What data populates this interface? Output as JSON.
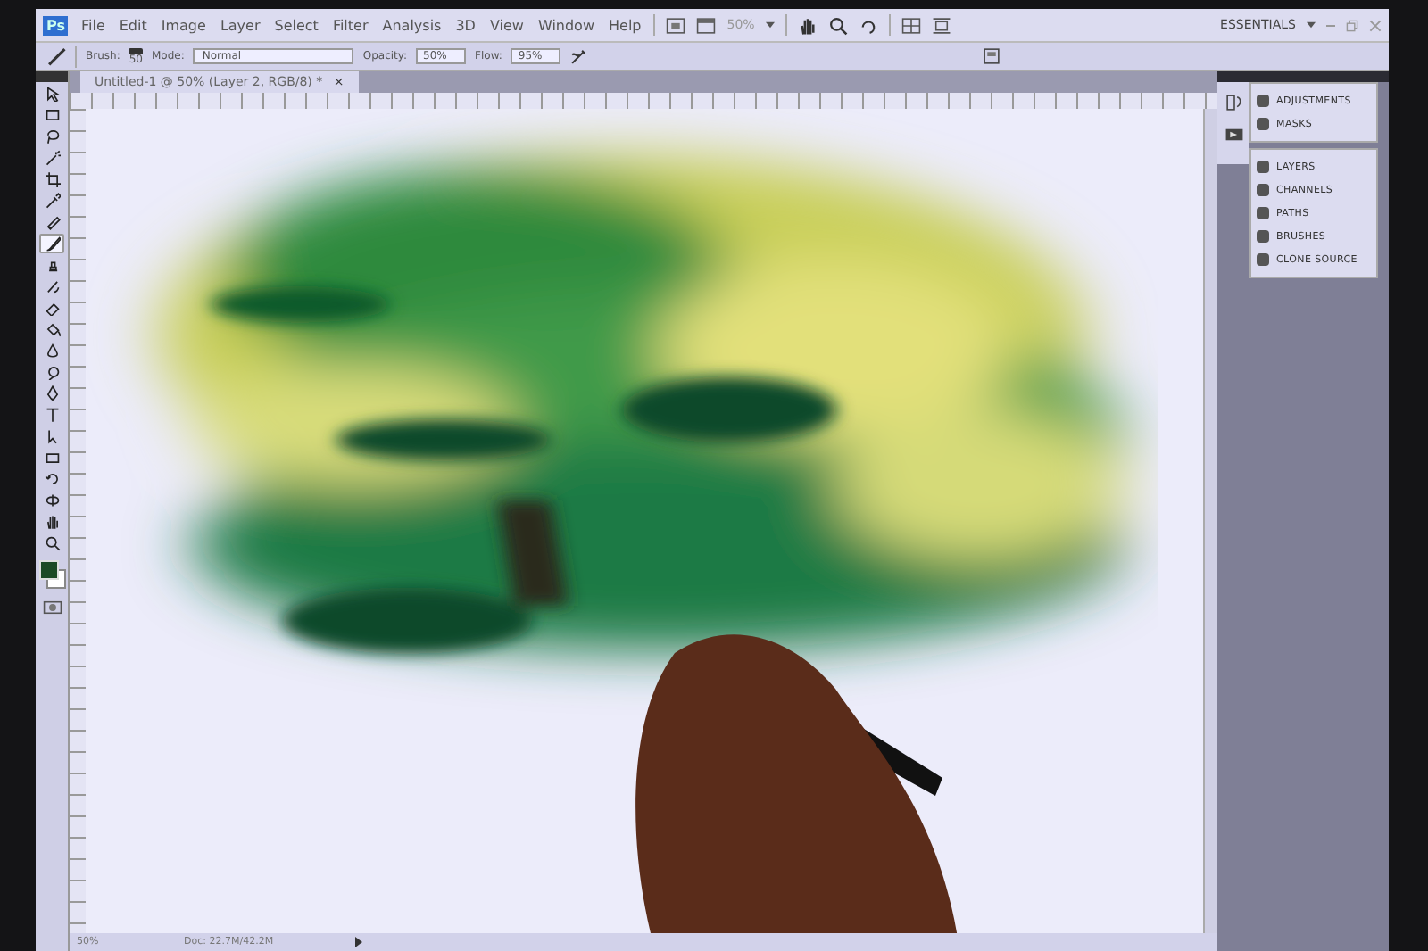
{
  "app_logo": "Ps",
  "menu": [
    "File",
    "Edit",
    "Image",
    "Layer",
    "Select",
    "Filter",
    "Analysis",
    "3D",
    "View",
    "Window",
    "Help"
  ],
  "app_bar": {
    "zoom": "50%",
    "workspace": "ESSENTIALS"
  },
  "options_bar": {
    "brush_label": "Brush:",
    "brush_size": "50",
    "mode_label": "Mode:",
    "mode": "Normal",
    "opacity_label": "Opacity:",
    "opacity": "50%",
    "flow_label": "Flow:",
    "flow": "95%"
  },
  "document_tab": {
    "title": "Untitled-1 @ 50% (Layer 2, RGB/8) *",
    "close": "×"
  },
  "tools": [
    {
      "kind": "move",
      "selected": false
    },
    {
      "kind": "marquee",
      "selected": false
    },
    {
      "kind": "lasso",
      "selected": false
    },
    {
      "kind": "wand",
      "selected": false
    },
    {
      "kind": "crop",
      "selected": false
    },
    {
      "kind": "eyedropper",
      "selected": false
    },
    {
      "kind": "healing",
      "selected": false
    },
    {
      "kind": "brush",
      "selected": true
    },
    {
      "kind": "stamp",
      "selected": false
    },
    {
      "kind": "history",
      "selected": false
    },
    {
      "kind": "eraser",
      "selected": false
    },
    {
      "kind": "bucket",
      "selected": false
    },
    {
      "kind": "blur",
      "selected": false
    },
    {
      "kind": "dodge",
      "selected": false
    },
    {
      "kind": "pen",
      "selected": false
    },
    {
      "kind": "type",
      "selected": false
    },
    {
      "kind": "select",
      "selected": false
    },
    {
      "kind": "shape",
      "selected": false
    },
    {
      "kind": "rotate",
      "selected": false
    },
    {
      "kind": "orbit",
      "selected": false
    },
    {
      "kind": "hand",
      "selected": false
    },
    {
      "kind": "zoom",
      "selected": false
    }
  ],
  "panel_groups": [
    [
      "ADJUSTMENTS",
      "MASKS"
    ],
    [
      "LAYERS",
      "CHANNELS",
      "PATHS",
      "BRUSHES",
      "CLONE SOURCE"
    ]
  ],
  "status_bar": {
    "zoom": "50%",
    "doc_size": "Doc: 22.7M/42.2M"
  }
}
